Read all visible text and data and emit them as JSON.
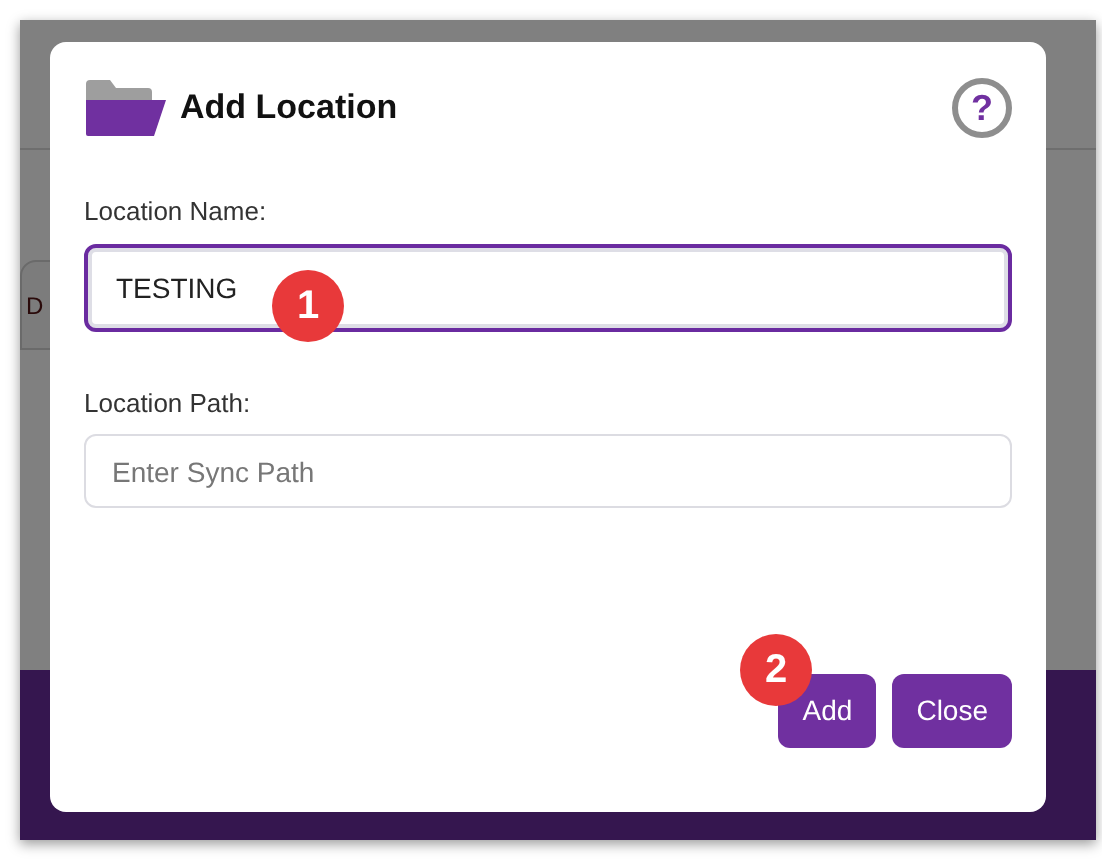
{
  "background": {
    "tab": {
      "label": "D"
    }
  },
  "dialog": {
    "title": "Add Location",
    "help": "?",
    "fields": [
      {
        "label": "Location Name:",
        "value": "TESTING",
        "focused": true
      },
      {
        "label": "Location Path:",
        "placeholder": "Enter Sync Path",
        "focused": false
      }
    ],
    "buttons": [
      {
        "label": "Add"
      },
      {
        "label": "Close"
      }
    ]
  },
  "annotations": [
    {
      "label": "1"
    },
    {
      "label": "2"
    }
  ]
}
